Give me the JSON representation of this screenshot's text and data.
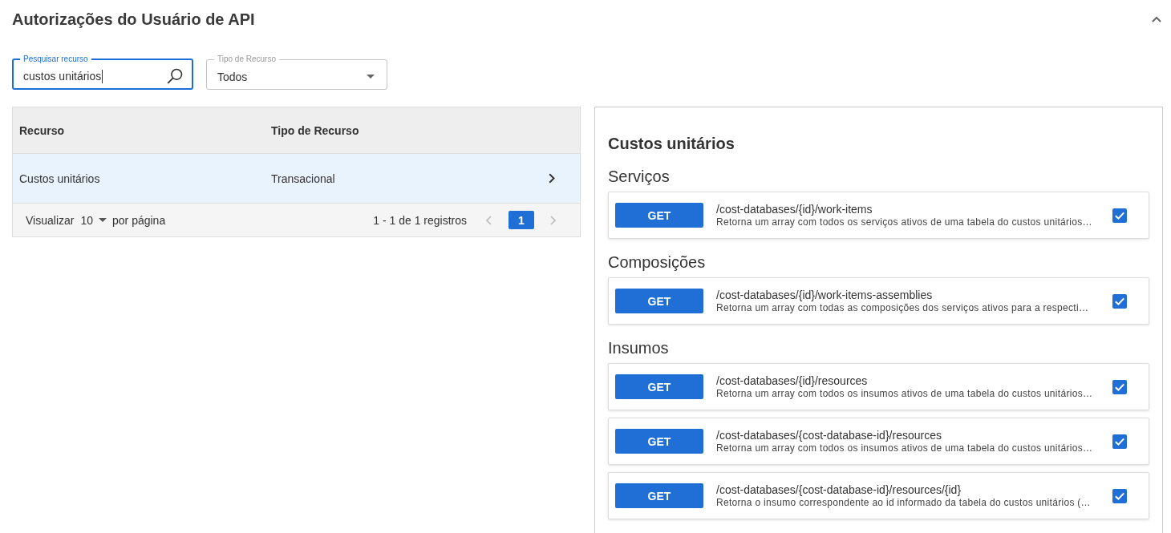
{
  "header": {
    "title": "Autorizações do Usuário de API",
    "expanded": true
  },
  "filters": {
    "search": {
      "label": "Pesquisar recurso",
      "value": "custos unitários",
      "focused": true
    },
    "resource_type": {
      "label": "Tipo de Recurso",
      "value": "Todos"
    }
  },
  "table": {
    "columns": [
      "Recurso",
      "Tipo de Recurso"
    ],
    "rows": [
      {
        "cells": [
          "Custos unitários",
          "Transacional"
        ],
        "selected": true
      }
    ],
    "footer": {
      "show_label": "Visualizar",
      "page_size": "10",
      "per_page_label": "por página",
      "range": "1 - 1 de 1 registros",
      "previous_disabled": true,
      "pages": [
        {
          "label": "1",
          "selected": true
        }
      ],
      "next_disabled": true
    }
  },
  "detail": {
    "title": "Custos unitários",
    "groups": [
      {
        "name": "Serviços",
        "endpoints": [
          {
            "method": "GET",
            "path": "/cost-databases/{id}/work-items",
            "description": "Retorna um array com todos os serviços ativos de uma tabela do custos unitários…",
            "checked": true
          }
        ]
      },
      {
        "name": "Composições",
        "endpoints": [
          {
            "method": "GET",
            "path": "/cost-databases/{id}/work-items-assemblies",
            "description": "Retorna um array com todas as composições dos serviços ativos para a respecti…",
            "checked": true
          }
        ]
      },
      {
        "name": "Insumos",
        "endpoints": [
          {
            "method": "GET",
            "path": "/cost-databases/{id}/resources",
            "description": "Retorna um array com todos os insumos ativos de uma tabela do custos unitários…",
            "checked": true
          },
          {
            "method": "GET",
            "path": "/cost-databases/{cost-database-id}/resources",
            "description": "Retorna um array com todos os insumos ativos de uma tabela do custos unitários…",
            "checked": true
          },
          {
            "method": "GET",
            "path": "/cost-databases/{cost-database-id}/resources/{id}",
            "description": "Retorna o insumo correspondente ao id informado da tabela do custos unitários (…",
            "checked": true
          }
        ]
      }
    ]
  }
}
